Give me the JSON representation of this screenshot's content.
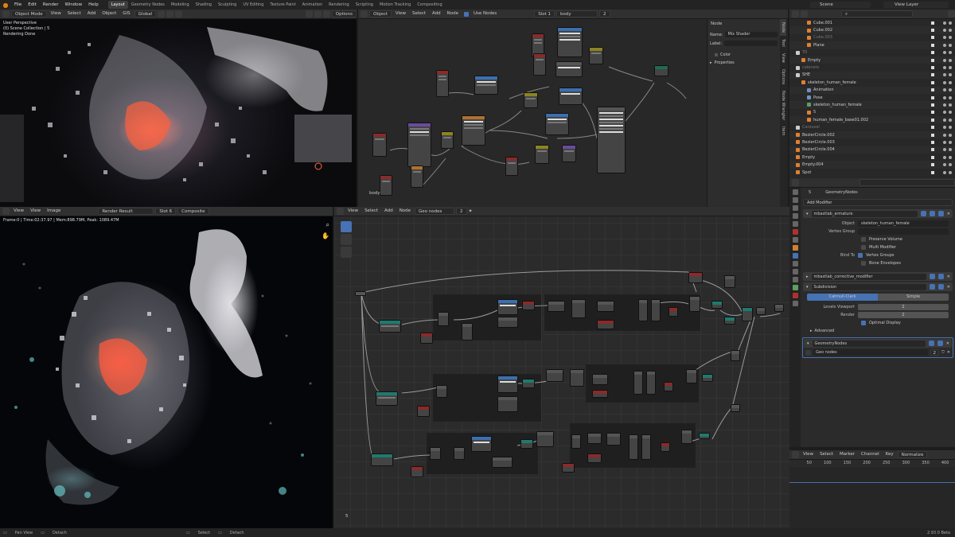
{
  "topbar": {
    "menus": [
      "File",
      "Edit",
      "Render",
      "Window",
      "Help"
    ],
    "workspaces": [
      "Layout",
      "Geometry Nodes",
      "Modeling",
      "Shading",
      "Sculpting",
      "UV Editing",
      "Texture Paint",
      "Animation",
      "Rendering",
      "Scripting",
      "Motion Tracking",
      "Compositing"
    ],
    "active_workspace": "Layout",
    "scene": "Scene",
    "view_layer": "View Layer"
  },
  "viewport3d": {
    "mode": "Object Mode",
    "menus": [
      "View",
      "Select",
      "Add",
      "Object",
      "GIS"
    ],
    "orientation": "Global",
    "options": "Options",
    "overlay_lines": [
      "User Perspective",
      "(0) Scene Collection | 5",
      "Rendering Done"
    ]
  },
  "shader_editor": {
    "type": "Object",
    "menus": [
      "View",
      "Select",
      "Add",
      "Node"
    ],
    "use_nodes_label": "Use Nodes",
    "slot": "Slot 1",
    "material": "body",
    "user_count": "2",
    "corner_label": "body",
    "npanel": {
      "section": "Node",
      "name_label": "Name:",
      "name_value": "Mix Shader",
      "label_label": "Label:",
      "label_value": "",
      "color_label": "Color",
      "properties_label": "Properties",
      "tabs": [
        "Node",
        "Tool",
        "View",
        "Options",
        "Node Wrangler",
        "Item"
      ]
    }
  },
  "outliner": {
    "search_placeholder": "",
    "rows": [
      {
        "name": "Cube.001",
        "indent": 2,
        "icon": "orange"
      },
      {
        "name": "Cube.002",
        "indent": 2,
        "icon": "orange"
      },
      {
        "name": "Cube.003",
        "indent": 2,
        "icon": "orange",
        "dim": true
      },
      {
        "name": "Plane",
        "indent": 2,
        "icon": "orange"
      },
      {
        "name": "TR",
        "indent": 0,
        "icon": "white",
        "dim": true
      },
      {
        "name": "Empty",
        "indent": 1,
        "icon": "orange"
      },
      {
        "name": "cabinets",
        "indent": 0,
        "icon": "white",
        "dim": true
      },
      {
        "name": "SHE",
        "indent": 0,
        "icon": "white"
      },
      {
        "name": "skeleton_human_female",
        "indent": 1,
        "icon": "orange"
      },
      {
        "name": "Animation",
        "indent": 2,
        "icon": "blue"
      },
      {
        "name": "Pose",
        "indent": 2,
        "icon": "blue"
      },
      {
        "name": "skeleton_human_female",
        "indent": 2,
        "icon": "green"
      },
      {
        "name": "5",
        "indent": 2,
        "icon": "orange"
      },
      {
        "name": "human_female_base01.002",
        "indent": 2,
        "icon": "orange"
      },
      {
        "name": "Carousel",
        "indent": 0,
        "icon": "white",
        "dim": true
      },
      {
        "name": "BezierCircle.002",
        "indent": 0,
        "icon": "orange"
      },
      {
        "name": "BezierCircle.003",
        "indent": 0,
        "icon": "orange"
      },
      {
        "name": "BezierCircle.004",
        "indent": 0,
        "icon": "orange"
      },
      {
        "name": "Empty",
        "indent": 0,
        "icon": "orange"
      },
      {
        "name": "Empty.004",
        "indent": 0,
        "icon": "orange"
      },
      {
        "name": "Spot",
        "indent": 0,
        "icon": "orange"
      }
    ]
  },
  "properties": {
    "object_name": "5",
    "modifier_context": "GeometryNodes",
    "add_modifier": "Add Modifier",
    "armature": {
      "name": "mbastlab_armature",
      "object_label": "Object",
      "object_value": "skeleton_human_female",
      "vertex_group_label": "Vertex Group",
      "preserve_volume": "Preserve Volume",
      "multi_modifier": "Multi Modifier",
      "bind_to_label": "Bind To",
      "vertex_groups": "Vertex Groups",
      "bone_envelopes": "Bone Envelopes"
    },
    "corrective": {
      "name": "mbastlab_corrective_modifier"
    },
    "subdivision": {
      "name": "Subdivision",
      "catmull": "Catmull-Clark",
      "simple": "Simple",
      "levels_viewport_label": "Levels Viewport",
      "levels_viewport": "2",
      "render_label": "Render",
      "render": "2",
      "optimal_display": "Optimal Display",
      "advanced": "Advanced"
    },
    "geonodes": {
      "name": "GeometryNodes",
      "tree": "Geo nodes",
      "users": "2"
    }
  },
  "timeline": {
    "menus": [
      "View",
      "Select",
      "Marker",
      "Channel",
      "Key"
    ],
    "normalize": "Normalize",
    "ticks": [
      "50",
      "100",
      "150",
      "200",
      "250",
      "300",
      "350",
      "400"
    ]
  },
  "image_editor": {
    "menus": [
      "View",
      "View",
      "Image"
    ],
    "image": "Render Result",
    "slot": "Slot 6",
    "layer": "Composite",
    "info": "Frame:0 | Time:02:37.97 | Mem:898.79M, Peak: 1089.47M"
  },
  "geo_editor": {
    "menus": [
      "View",
      "Select",
      "Add",
      "Node"
    ],
    "tree": "Geo nodes",
    "users": "2",
    "corner_label": "5"
  },
  "status": {
    "pan_view": "Pan View",
    "detach": "Detach",
    "select": "Select",
    "detach2": "Detach",
    "version": "2.93.0 Beta"
  }
}
